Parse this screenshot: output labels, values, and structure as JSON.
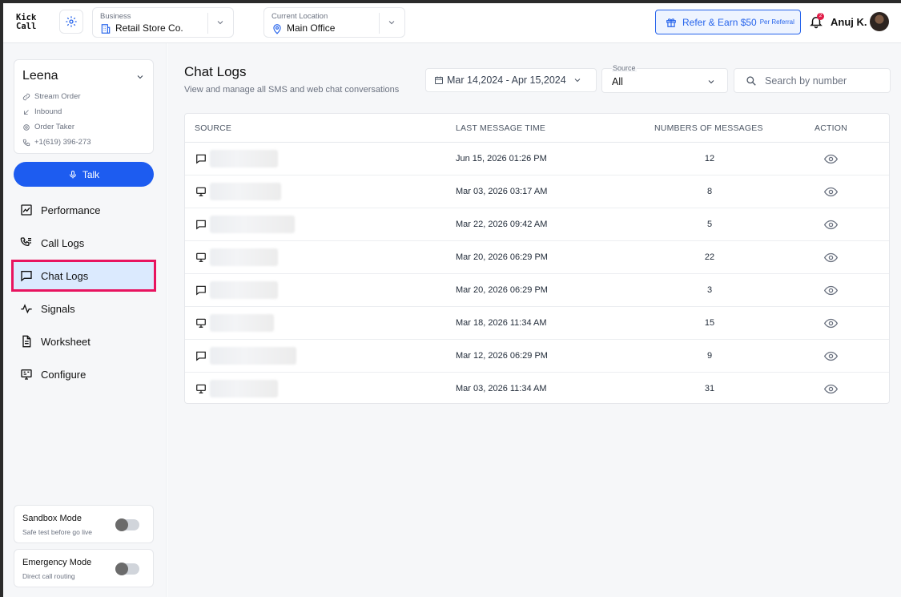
{
  "header": {
    "logo_line1": "Kick",
    "logo_line2": "Call",
    "business": {
      "label": "Business",
      "value": "Retail Store Co."
    },
    "location": {
      "label": "Current Location",
      "value": "Main Office"
    },
    "refer": {
      "label": "Refer & Earn $50",
      "sub": "Per Referral"
    },
    "notification_count": "2",
    "user_name": "Anuj K."
  },
  "agent": {
    "name": "Leena",
    "workflow": "Stream Order",
    "direction": "Inbound",
    "role": "Order Taker",
    "phone": "+1(619) 396-273"
  },
  "talk_button": "Talk",
  "nav": [
    {
      "label": "Performance",
      "icon": "chart-icon"
    },
    {
      "label": "Call Logs",
      "icon": "call-list-icon"
    },
    {
      "label": "Chat Logs",
      "icon": "chat-icon",
      "active": true
    },
    {
      "label": "Signals",
      "icon": "pulse-icon"
    },
    {
      "label": "Worksheet",
      "icon": "document-icon"
    },
    {
      "label": "Configure",
      "icon": "configure-icon"
    }
  ],
  "modes": [
    {
      "title": "Sandbox Mode",
      "sub": "Safe test before go live",
      "on": false
    },
    {
      "title": "Emergency Mode",
      "sub": "Direct call routing",
      "on": false
    }
  ],
  "page": {
    "title": "Chat Logs",
    "subtitle": "View and manage all SMS and web chat conversations",
    "date_range": "Mar 14,2024 - Apr 15,2024",
    "source_label": "Source",
    "source_value": "All",
    "search_placeholder": "Search by number"
  },
  "table": {
    "headers": {
      "source": "SOURCE",
      "time": "LAST MESSAGE TIME",
      "count": "NUMBERS OF MESSAGES",
      "action": "ACTION"
    },
    "rows": [
      {
        "type": "sms",
        "time": "Jun 15, 2026 01:26 PM",
        "count": "12"
      },
      {
        "type": "web",
        "time": "Mar 03, 2026 03:17 AM",
        "count": "8"
      },
      {
        "type": "sms",
        "time": "Mar 22, 2026 09:42 AM",
        "count": "5"
      },
      {
        "type": "web",
        "time": "Mar 20, 2026 06:29 PM",
        "count": "22"
      },
      {
        "type": "sms",
        "time": "Mar 20, 2026 06:29 PM",
        "count": "3"
      },
      {
        "type": "web",
        "time": "Mar 18, 2026 11:34 AM",
        "count": "15"
      },
      {
        "type": "sms",
        "time": "Mar 12, 2026 06:29 PM",
        "count": "9"
      },
      {
        "type": "web",
        "time": "Mar 03, 2026 11:34 AM",
        "count": "31"
      }
    ]
  },
  "colors": {
    "accent": "#1d5cf0",
    "highlight": "#e8145f",
    "active_bg": "#dbeafe"
  }
}
